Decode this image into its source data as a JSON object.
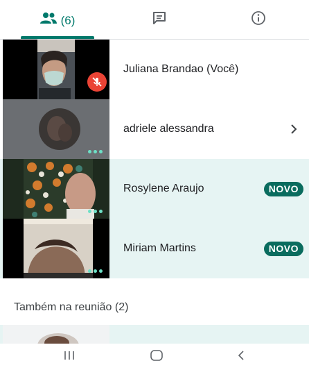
{
  "tabs": {
    "people_count": "(6)",
    "people_icon": "people-icon",
    "chat_icon": "chat-icon",
    "info_icon": "info-icon"
  },
  "participants": [
    {
      "name": "Juliana Brandao (Você)",
      "muted": true
    },
    {
      "name": "adriele alessandra",
      "has_chevron": true
    },
    {
      "name": "Rosylene Araujo",
      "badge": "NOVO"
    },
    {
      "name": "Miriam Martins",
      "badge": "NOVO"
    }
  ],
  "section": {
    "label": "Também na reunião (2)"
  },
  "colors": {
    "accent": "#00796b",
    "badge_bg": "#0a6c5e",
    "highlight_bg": "#e6f4f3",
    "mic_off": "#ea4335",
    "dots": "#6de0c6"
  },
  "navbar": {
    "recent_icon": "recent-apps-icon",
    "home_icon": "home-icon",
    "back_icon": "back-icon"
  }
}
